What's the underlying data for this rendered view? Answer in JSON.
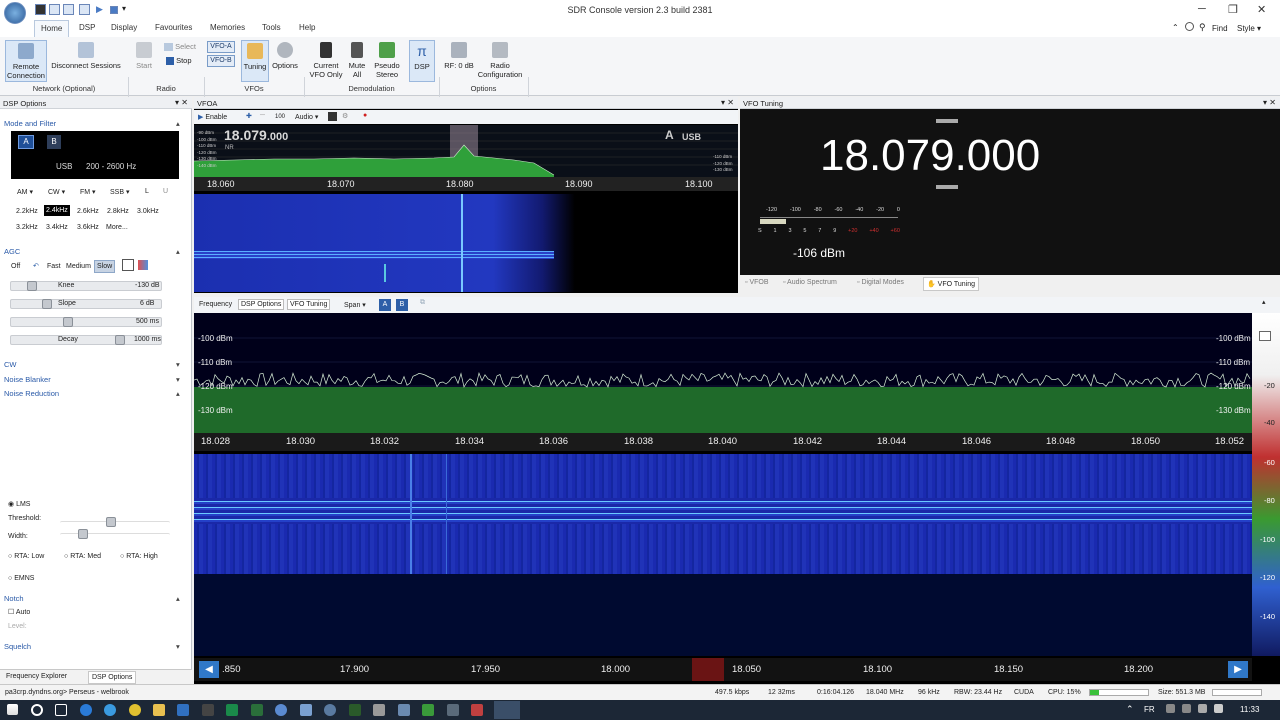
{
  "window": {
    "title": "SDR Console version 2.3 build 2381",
    "find": "Find",
    "style": "Style"
  },
  "menu": [
    "Home",
    "DSP",
    "Display",
    "Favourites",
    "Memories",
    "Tools",
    "Help"
  ],
  "ribbon": {
    "remote": "Remote Connection",
    "disconnect": "Disconnect Sessions",
    "start": "Start",
    "select": "Select",
    "stop": "Stop",
    "vfoa": "VFO-A",
    "vfob": "VFO-B",
    "tuning": "Tuning",
    "options": "Options",
    "current": "Current VFO Only",
    "mute": "Mute All",
    "pseudo": "Pseudo Stereo",
    "dsp": "DSP",
    "rf": "RF: 0 dB",
    "radio": "Radio Configuration",
    "groups": [
      "Network (Optional)",
      "Radio",
      "VFOs",
      "Demodulation",
      "Options"
    ]
  },
  "dsp": {
    "title": "DSP Options",
    "mode_filter": "Mode and Filter",
    "btn_a": "A",
    "btn_b": "B",
    "mode": "USB",
    "bw": "200 - 2600 Hz",
    "modes": [
      "AM",
      "CW",
      "FM",
      "SSB",
      "L",
      "U"
    ],
    "filters1": [
      "2.2kHz",
      "2.4kHz",
      "2.6kHz",
      "2.8kHz",
      "3.0kHz"
    ],
    "filters2": [
      "3.2kHz",
      "3.4kHz",
      "3.6kHz",
      "More..."
    ],
    "agc": "AGC",
    "agc_modes": [
      "Off",
      "Fast",
      "Medium",
      "Slow"
    ],
    "knee": "Knee",
    "knee_val": "-130 dB",
    "slope": "Slope",
    "slope_val": "6 dB",
    "hang_val": "500 ms",
    "decay": "Decay",
    "decay_val": "1000 ms",
    "cw": "CW",
    "nb": "Noise Blanker",
    "nr": "Noise Reduction",
    "lms": "LMS",
    "threshold": "Threshold:",
    "width": "Width:",
    "rta": [
      "RTA: Low",
      "RTA: Med",
      "RTA: High"
    ],
    "emns": "EMNS",
    "notch": "Notch",
    "auto": "Auto",
    "level": "Level:",
    "squelch": "Squelch",
    "tabs": [
      "Frequency Explorer",
      "DSP Options"
    ]
  },
  "vfoa": {
    "title": "VFOA",
    "enable": "Enable",
    "step": "100",
    "audio": "Audio",
    "freq_main": "18.079",
    "freq_sub": ".000",
    "nr": "NR",
    "vfo": "A",
    "mode": "USB",
    "scale": [
      "18.060",
      "18.070",
      "18.080",
      "18.090",
      "18.100"
    ],
    "dbl": [
      "-90 dBm",
      "-100 dBm",
      "-110 dBm",
      "-120 dBm",
      "-130 dBm",
      "-140 dBm"
    ]
  },
  "vfotune": {
    "title": "VFO Tuning",
    "freq": "18.079.000",
    "sm1": [
      "-120",
      "-100",
      "-80",
      "-60",
      "-40",
      "-20",
      "0"
    ],
    "sm2": [
      "S",
      "1",
      "3",
      "5",
      "7",
      "9",
      "+20",
      "+40",
      "+60"
    ],
    "level": "-106 dBm",
    "tabs": [
      "VFOB",
      "Audio Spectrum",
      "Digital Modes",
      "VFO Tuning"
    ]
  },
  "main": {
    "tabs": [
      "Frequency",
      "DSP Options",
      "VFO Tuning"
    ],
    "span": "Span",
    "a": "A",
    "b": "B",
    "dbm": [
      "-100 dBm",
      "-110 dBm",
      "-120 dBm",
      "-130 dBm"
    ],
    "scale": [
      "18.028",
      "18.030",
      "18.032",
      "18.034",
      "18.036",
      "18.038",
      "18.040",
      "18.042",
      "18.044",
      "18.046",
      "18.048",
      "18.050",
      "18.052"
    ],
    "cbar": [
      "-20",
      "-40",
      "-60",
      "-80",
      "-100",
      "-120",
      "-140"
    ],
    "overview": [
      ".850",
      "17.900",
      "17.950",
      "18.000",
      "18.050",
      "18.100",
      "18.150",
      "18.200"
    ]
  },
  "status": {
    "host": "pa3crp.dyndns.org> Perseus - welbrook",
    "kb": "497.5 kbps",
    "time1": "12 32ms",
    "time2": "0:16:04.126",
    "center": "18.040 MHz",
    "khz": "96 kHz",
    "rbw": "RBW: 23.44 Hz",
    "cuda": "CUDA",
    "cpu": "CPU: 15%",
    "size": "Size: 551.3 MB"
  },
  "taskbar": {
    "lang": "FR",
    "clock": "11:33"
  }
}
